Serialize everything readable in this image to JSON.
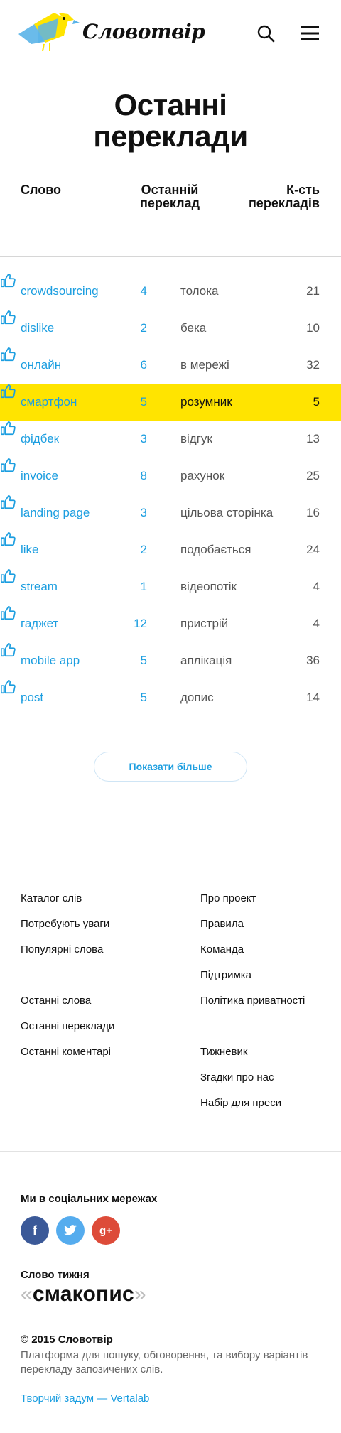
{
  "header": {
    "brand": "Словотвір",
    "search_icon": "search-icon",
    "menu_icon": "hamburger-menu-icon",
    "logo_colors": {
      "blue": "#5ab4e8",
      "yellow": "#ffe400"
    }
  },
  "title": {
    "line1": "Останні",
    "line2": "переклади"
  },
  "table": {
    "col_word": "Слово",
    "col_last_line1": "Останній",
    "col_last_line2": "переклад",
    "col_count_line1": "К-сть",
    "col_count_line2": "перекладів",
    "rows": [
      {
        "word": "crowdsourcing",
        "votes": "4",
        "translation": "толока",
        "count": "21"
      },
      {
        "word": "dislike",
        "votes": "2",
        "translation": "бека",
        "count": "10"
      },
      {
        "word": "онлайн",
        "votes": "6",
        "translation": "в мережі",
        "count": "32"
      },
      {
        "word": "смартфон",
        "votes": "5",
        "translation": "розумник",
        "count": "5"
      },
      {
        "word": "фідбек",
        "votes": "3",
        "translation": "відгук",
        "count": "13"
      },
      {
        "word": "invoice",
        "votes": "8",
        "translation": "рахунок",
        "count": "25"
      },
      {
        "word": "landing page",
        "votes": "3",
        "translation": "цільова сторінка",
        "count": "16"
      },
      {
        "word": "like",
        "votes": "2",
        "translation": "подобається",
        "count": "24"
      },
      {
        "word": "stream",
        "votes": "1",
        "translation": "відеопотік",
        "count": "4"
      },
      {
        "word": "гаджет",
        "votes": "12",
        "translation": "пристрій",
        "count": "4"
      },
      {
        "word": "mobile app",
        "votes": "5",
        "translation": "аплікація",
        "count": "36"
      },
      {
        "word": "post",
        "votes": "5",
        "translation": "допис",
        "count": "14"
      }
    ],
    "highlight_color": "#ffe400",
    "link_color": "#1c9ee0"
  },
  "show_more": "Показати більше",
  "footer": {
    "left": {
      "group1": [
        "Каталог слів",
        "Потребують уваги",
        "Популярні слова"
      ],
      "group2": [
        "Останні слова",
        "Останні переклади",
        "Останні коментарі"
      ]
    },
    "right": {
      "group1": [
        "Про проект",
        "Правила",
        "Команда",
        "Підтримка",
        "Політика приватності"
      ],
      "group2": [
        "Тижневик",
        "Згадки про нас",
        "Набір для преси"
      ]
    },
    "social_title": "Ми в соціальних мережах",
    "social": {
      "facebook": "f",
      "twitter_icon": "twitter-bird-icon",
      "googleplus": "g+"
    },
    "word_of_week_label": "Слово тижня",
    "word_of_week": "смакопис",
    "quote_open": "«",
    "quote_close": "»",
    "copyright": "© 2015 Словотвір",
    "description": "Платформа для пошуку, обговорення, та вибору варіантів перекладу запозичених слів.",
    "credit": "Творчий задум — Vertalab"
  }
}
